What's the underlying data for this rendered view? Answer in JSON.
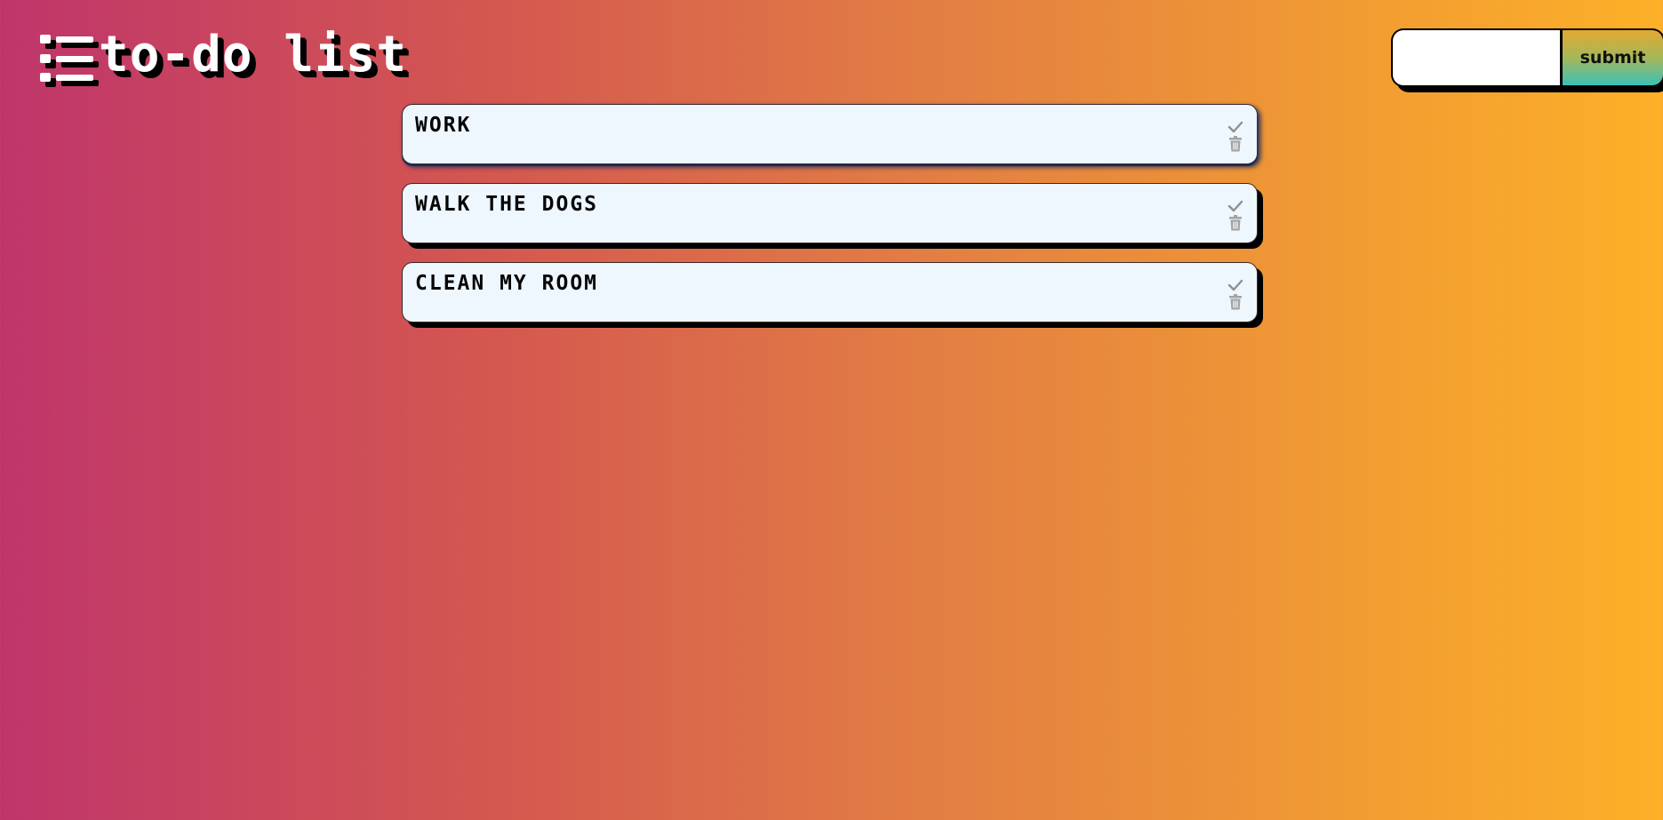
{
  "app": {
    "title": "to-do list",
    "logo_icon": "list-icon"
  },
  "add_form": {
    "input_value": "",
    "input_placeholder": "",
    "submit_label": "submit"
  },
  "todos": [
    {
      "text": "WORK",
      "check_icon": "check-icon",
      "delete_icon": "trash-icon"
    },
    {
      "text": "WALK THE DOGS",
      "check_icon": "check-icon",
      "delete_icon": "trash-icon"
    },
    {
      "text": "CLEAN MY ROOM",
      "check_icon": "check-icon",
      "delete_icon": "trash-icon"
    }
  ],
  "colors": {
    "gradient_start": "#bf356b",
    "gradient_end": "#fdb028",
    "item_background": "#eef6fe",
    "icon_color": "#9a9a9a"
  }
}
